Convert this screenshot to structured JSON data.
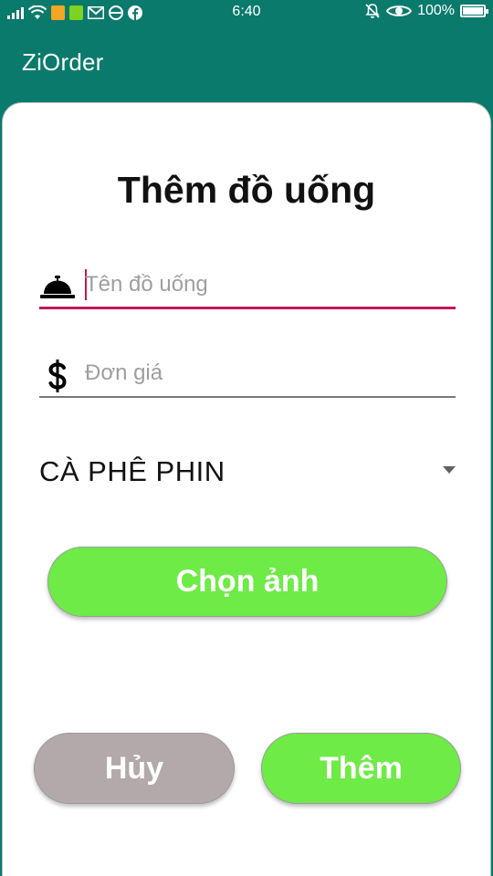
{
  "status_bar": {
    "time": "6:40",
    "battery_text": "100%",
    "battery_level": 1.0,
    "icons": [
      "signal-icon",
      "wifi-icon",
      "app-notification-icon",
      "battery-saver-icon",
      "gmail-icon",
      "app-icon",
      "facebook-icon",
      "bell-muted-icon",
      "eye-icon",
      "battery-icon"
    ]
  },
  "app_bar": {
    "title": "ZiOrder"
  },
  "dialog": {
    "title": "Thêm đồ uống",
    "name_field": {
      "placeholder": "Tên đồ uống",
      "value": "",
      "icon": "service-bell-icon"
    },
    "price_field": {
      "placeholder": "Đơn giá",
      "value": "",
      "icon": "dollar-icon"
    },
    "category_select": {
      "selected": "CÀ PHÊ PHIN"
    },
    "choose_image_label": "Chọn ảnh",
    "cancel_label": "Hủy",
    "add_label": "Thêm"
  },
  "colors": {
    "primary": "#0a7a6c",
    "accent": "#c2185b",
    "button_green": "#6eeb46",
    "button_gray": "#b3a9aa"
  }
}
